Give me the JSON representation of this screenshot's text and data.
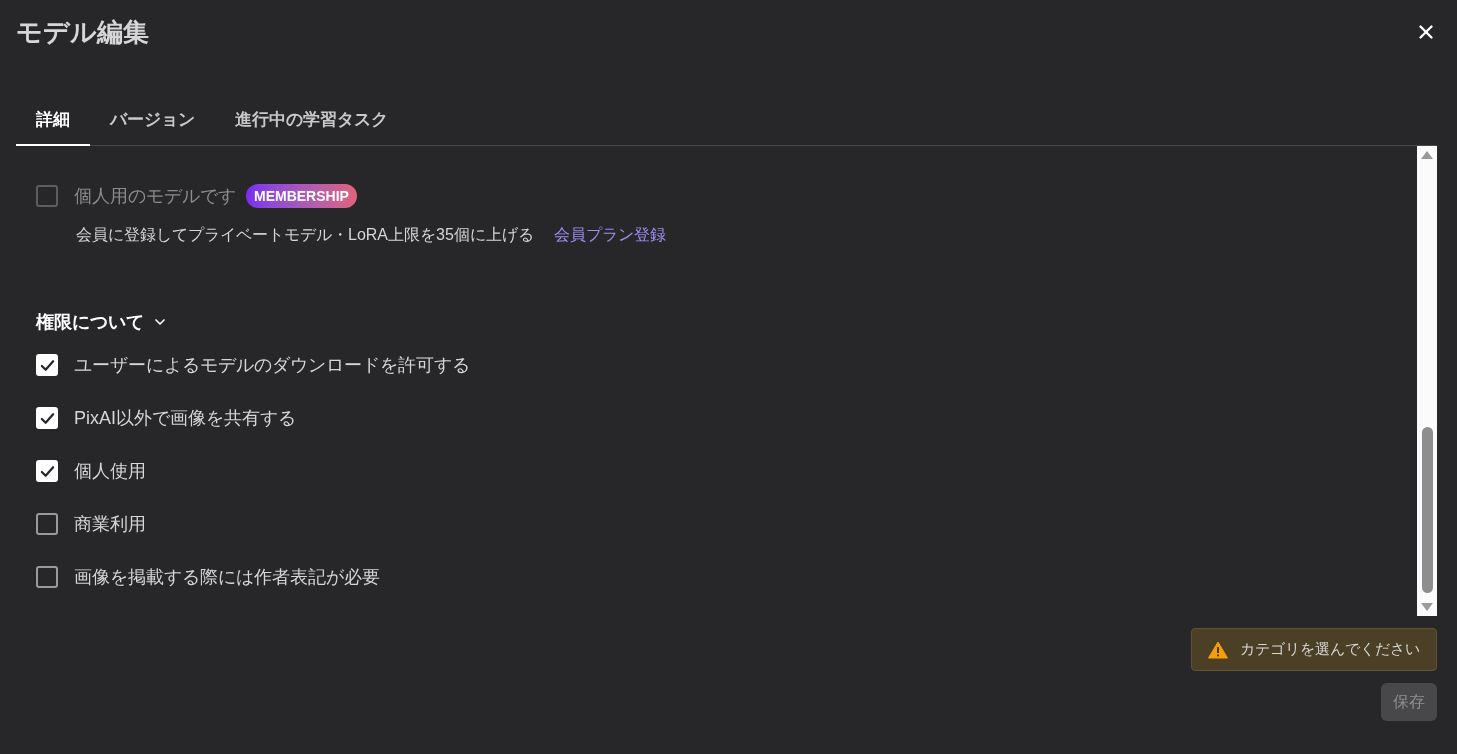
{
  "dialog": {
    "title": "モデル編集"
  },
  "tabs": [
    {
      "label": "詳細",
      "selected": true
    },
    {
      "label": "バージョン",
      "selected": false
    },
    {
      "label": "進行中の学習タスク",
      "selected": false
    }
  ],
  "private_model": {
    "label": "個人用のモデルです",
    "checked": false,
    "disabled": true,
    "badge": "MEMBERSHIP",
    "note": "会員に登録してプライベートモデル・LoRA上限を35個に上げる",
    "link": "会員プラン登録"
  },
  "permissions": {
    "heading": "権限について",
    "expanded": true,
    "options": [
      {
        "label": "ユーザーによるモデルのダウンロードを許可する",
        "checked": true
      },
      {
        "label": "PixAI以外で画像を共有する",
        "checked": true
      },
      {
        "label": "個人使用",
        "checked": true
      },
      {
        "label": "商業利用",
        "checked": false
      },
      {
        "label": "画像を掲載する際には作者表記が必要",
        "checked": false
      }
    ]
  },
  "alert": {
    "message": "カテゴリを選んでください"
  },
  "save_button": {
    "label": "保存",
    "disabled": true
  }
}
